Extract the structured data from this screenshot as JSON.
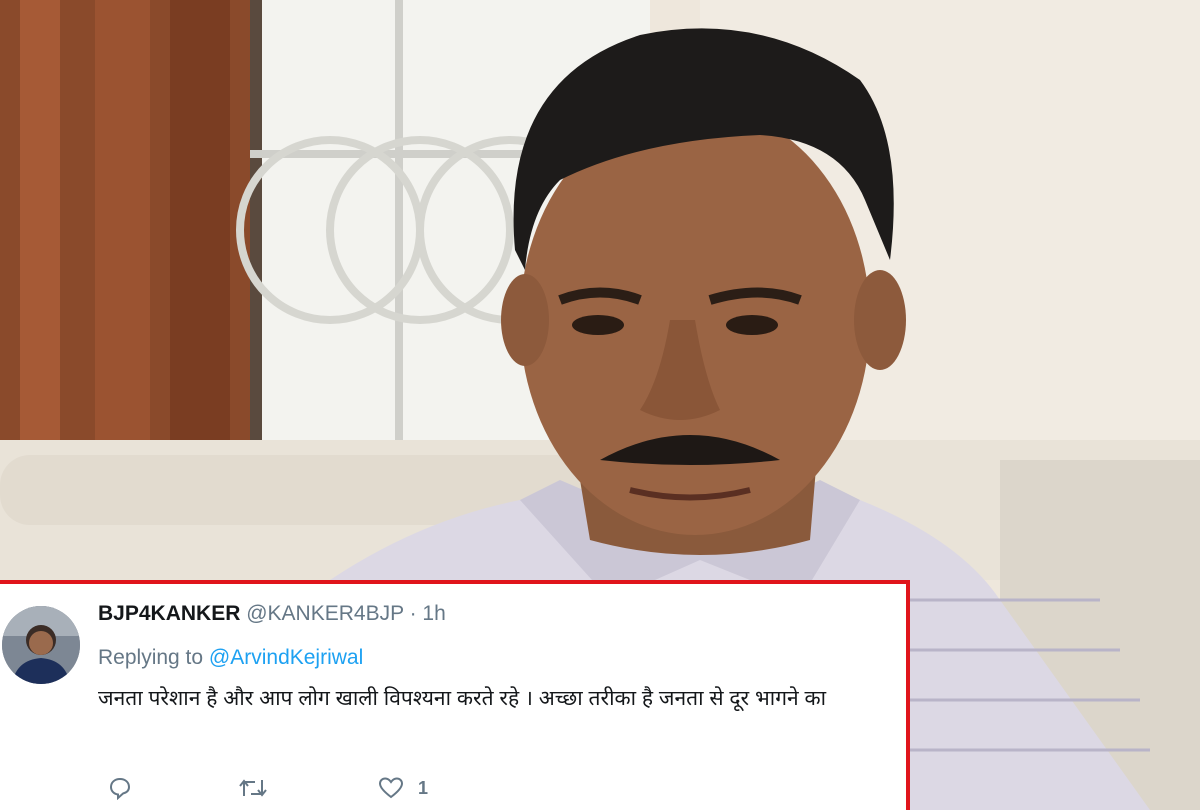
{
  "tweet": {
    "display_name": "BJP4KANKER",
    "handle": "@KANKER4BJP",
    "separator": "·",
    "time": "1h",
    "reply_prefix": "Replying to",
    "reply_to": "@ArvindKejriwal",
    "text": "जनता परेशान है और आप लोग खाली विपश्यना करते रहे । अच्छा तरीका है जनता से दूर भागने का",
    "like_count": "1"
  },
  "icons": {
    "reply": "reply-icon",
    "retweet": "retweet-icon",
    "like": "heart-icon"
  },
  "colors": {
    "highlight_border": "#e0141b",
    "link": "#1da1f2",
    "secondary_text": "#657786",
    "primary_text": "#14171a"
  }
}
